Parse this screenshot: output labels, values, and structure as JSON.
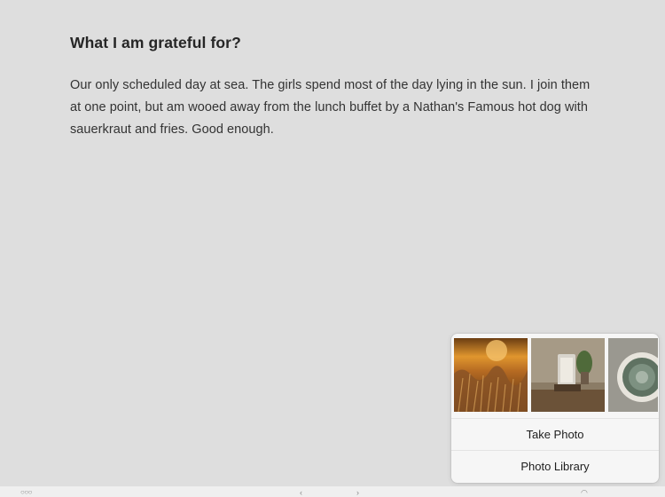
{
  "entry": {
    "prompt_title": "What I am grateful for?",
    "body": "Our only scheduled day at sea. The girls spend most of the day lying in the sun. I join them at one point, but am wooed away from the lunch buffet by a Nathan's Famous hot dog with sauerkraut and fries. Good enough."
  },
  "photo_popover": {
    "thumbnails": [
      {
        "icon": "photo-dry-grass-sunset"
      },
      {
        "icon": "photo-desk-tablet-plant"
      },
      {
        "icon": "photo-cactus-closeup"
      }
    ],
    "take_photo_label": "Take Photo",
    "photo_library_label": "Photo Library"
  },
  "bottom_bar": {
    "more_icon": "more-icon",
    "back_icon": "back-arrow-icon",
    "forward_icon": "forward-arrow-icon",
    "camera_icon": "camera-icon"
  },
  "colors": {
    "background": "#dedede",
    "popover": "#f6f6f6",
    "text": "#2b2b2b"
  }
}
